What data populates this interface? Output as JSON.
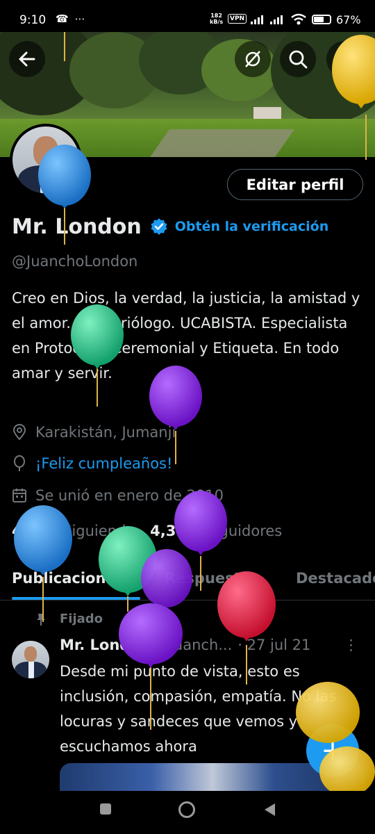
{
  "status_bar": {
    "time": "9:10",
    "left_icons": "☎ ⋯",
    "net_speed_value": "182",
    "net_speed_unit": "kB/s",
    "vpn": "VPN",
    "battery": "67%"
  },
  "profile": {
    "name": "Mr. London",
    "get_verified": "Obtén la verificación",
    "handle": "@JuanchoLondon",
    "edit_button": "Editar perfil",
    "bio": "Creo en Dios, la verdad, la justicia, la amistad y el amor. Industriólogo. UCABISTA. Especialista en Protocolo, Ceremonial y Etiqueta. En todo amar y servir.",
    "location": "Karakistán, Jumanji",
    "birthday": "¡Feliz cumpleaños!",
    "joined": "Se unió en enero de 2010",
    "following_count": "4,341",
    "following_label": "Siguiendo",
    "followers_count": "4,309",
    "followers_label": "Seguidores"
  },
  "tabs": [
    {
      "label": "Publicaciones",
      "active": true
    },
    {
      "label": "Respuestas",
      "active": false
    },
    {
      "label": "Destacados",
      "active": false
    }
  ],
  "pinned_tweet": {
    "pinned_label": "Fijado",
    "author": "Mr. London",
    "handle": "@Juanch...",
    "date": "· 27 jul 21",
    "text": "Desde mi punto de vista, esto es inclusión, compasión, empatía. No las locuras y sandeces que vemos y escuchamos ahora"
  },
  "fab": {
    "label": "+"
  },
  "colors": {
    "accent": "#1d9bf0",
    "background": "#000000",
    "muted_text": "#71767b",
    "balloon_blue": "#2b8de0",
    "balloon_green": "#27c78c",
    "balloon_purple": "#8a2be2",
    "balloon_red": "#e8204a",
    "balloon_yellow": "#f2c418"
  },
  "icons": {
    "back": "back-arrow-icon",
    "hide": "eye-off-icon",
    "search": "search-icon",
    "more": "more-vertical-icon",
    "verified": "verified-badge-icon",
    "location": "location-pin-icon",
    "birthday": "balloon-icon",
    "calendar": "calendar-icon",
    "pin": "pin-icon"
  }
}
